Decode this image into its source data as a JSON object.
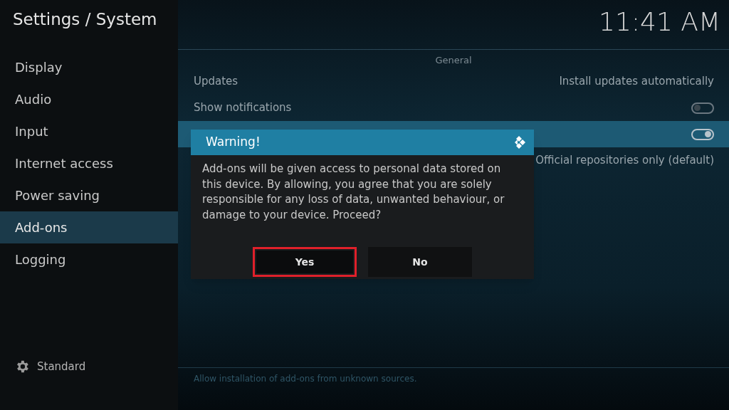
{
  "header": {
    "title": "Settings / System",
    "clock": "11:41 AM"
  },
  "sidebar": {
    "items": [
      {
        "label": "Display",
        "selected": false
      },
      {
        "label": "Audio",
        "selected": false
      },
      {
        "label": "Input",
        "selected": false
      },
      {
        "label": "Internet access",
        "selected": false
      },
      {
        "label": "Power saving",
        "selected": false
      },
      {
        "label": "Add-ons",
        "selected": true
      },
      {
        "label": "Logging",
        "selected": false
      }
    ],
    "level_button": "Standard"
  },
  "section": {
    "title": "General",
    "rows": [
      {
        "kind": "value",
        "label": "Updates",
        "value": "Install updates automatically",
        "focused": false
      },
      {
        "kind": "toggle",
        "label": "Show notifications",
        "on": false,
        "focused": false
      },
      {
        "kind": "toggle",
        "on": true,
        "focused": true
      },
      {
        "kind": "value",
        "value": "Official repositories only (default)",
        "focused": false
      }
    ]
  },
  "description": "Allow installation of add-ons from unknown sources.",
  "dialog": {
    "title": "Warning!",
    "message": "Add-ons will be given access to personal data stored on this device. By allowing, you agree that you are solely responsible for any loss of data, unwanted behaviour, or damage to your device. Proceed?",
    "buttons": [
      {
        "label": "Yes",
        "selected": true
      },
      {
        "label": "No",
        "selected": false
      }
    ]
  }
}
